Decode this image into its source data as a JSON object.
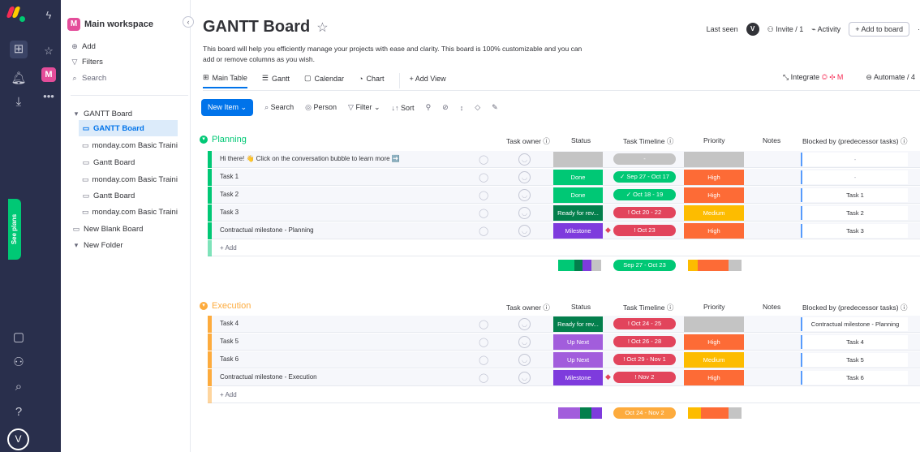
{
  "leftbar": {
    "avatar": "V"
  },
  "sidebar": {
    "workspace_title": "Main workspace",
    "workspace_badge": "M",
    "add": "Add",
    "filters": "Filters",
    "search": "Search",
    "items": [
      {
        "label": "GANTT Board",
        "type": "folder-open"
      },
      {
        "label": "GANTT Board",
        "type": "board",
        "active": true
      },
      {
        "label": "monday.com Basic Traini...",
        "type": "board"
      },
      {
        "label": "Gantt Board",
        "type": "board"
      },
      {
        "label": "monday.com Basic Traini...",
        "type": "board"
      },
      {
        "label": "Gantt Board",
        "type": "board"
      },
      {
        "label": "monday.com Basic Traini...",
        "type": "board"
      },
      {
        "label": "New Blank Board",
        "type": "board"
      },
      {
        "label": "New Folder",
        "type": "folder-open"
      }
    ],
    "see_plans": "See plans"
  },
  "header": {
    "title": "GANTT Board",
    "description": "This board will help you efficiently manage your projects with ease and clarity. This board is 100% customizable and you can add or remove columns as you wish.",
    "last_seen": "Last seen",
    "last_seen_avatar": "V",
    "invite": "Invite / 1",
    "activity": "Activity",
    "add_to_board": "+ Add to board"
  },
  "tabs": [
    "Main Table",
    "Gantt",
    "Calendar",
    "Chart",
    "+ Add View"
  ],
  "tabs_right": {
    "integrate": "Integrate",
    "automate": "Automate / 4"
  },
  "toolbar": {
    "new_item": "New Item",
    "search": "Search",
    "person": "Person",
    "filter": "Filter",
    "sort": "Sort"
  },
  "columns": {
    "owner": "Task owner",
    "status": "Status",
    "timeline": "Task Timeline",
    "priority": "Priority",
    "notes": "Notes",
    "blocked": "Blocked by (predecessor tasks)"
  },
  "groups": [
    {
      "name": "Planning",
      "color": "#00c875",
      "rows": [
        {
          "name": "Hi there! 👋 Click on the conversation bubble to learn more ➡️",
          "status": "",
          "status_color": "#c4c4c4",
          "timeline": "-",
          "timeline_color": "#c4c4c4",
          "priority": "",
          "priority_color": "#c4c4c4",
          "blocked": "-"
        },
        {
          "name": "Task 1",
          "status": "Done",
          "status_color": "#00c875",
          "timeline": "✓ Sep 27 - Oct 17",
          "timeline_color": "#00c875",
          "priority": "High",
          "priority_color": "#fd6b36",
          "blocked": "-"
        },
        {
          "name": "Task 2",
          "status": "Done",
          "status_color": "#00c875",
          "timeline": "✓  Oct 18 - 19",
          "timeline_color": "#00c875",
          "priority": "High",
          "priority_color": "#fd6b36",
          "blocked": "Task 1"
        },
        {
          "name": "Task 3",
          "status": "Ready for rev...",
          "status_color": "#037f4c",
          "timeline": "!  Oct 20 - 22",
          "timeline_color": "#e2445c",
          "priority": "Medium",
          "priority_color": "#fdbc00",
          "blocked": "Task 2"
        },
        {
          "name": "Contractual milestone - Planning",
          "status": "Milestone",
          "status_color": "#7e3bdd",
          "timeline": "!    Oct 23",
          "timeline_color": "#e2445c",
          "priority": "High",
          "priority_color": "#fd6b36",
          "blocked": "Task 3"
        }
      ],
      "add_label": "+ Add",
      "summary_timeline": "Sep 27 - Oct 23"
    },
    {
      "name": "Execution",
      "color": "#fdab3d",
      "rows": [
        {
          "name": "Task 4",
          "status": "Ready for rev...",
          "status_color": "#037f4c",
          "timeline": "!  Oct 24 - 25",
          "timeline_color": "#e2445c",
          "priority": "",
          "priority_color": "#c4c4c4",
          "blocked": "Contractual milestone - Planning"
        },
        {
          "name": "Task 5",
          "status": "Up Next",
          "status_color": "#a25ddc",
          "timeline": "!  Oct 26 - 28",
          "timeline_color": "#e2445c",
          "priority": "High",
          "priority_color": "#fd6b36",
          "blocked": "Task 4"
        },
        {
          "name": "Task 6",
          "status": "Up Next",
          "status_color": "#a25ddc",
          "timeline": "! Oct 29 - Nov 1",
          "timeline_color": "#e2445c",
          "priority": "Medium",
          "priority_color": "#fdbc00",
          "blocked": "Task 5"
        },
        {
          "name": "Contractual milestone - Execution",
          "status": "Milestone",
          "status_color": "#7e3bdd",
          "timeline": "!    Nov 2",
          "timeline_color": "#e2445c",
          "priority": "High",
          "priority_color": "#fd6b36",
          "blocked": "Task 6"
        }
      ],
      "add_label": "+ Add",
      "summary_timeline": "Oct 24 - Nov 2"
    }
  ],
  "colors": {
    "accent": "#0073ea",
    "nav_bg": "#292f4c"
  }
}
